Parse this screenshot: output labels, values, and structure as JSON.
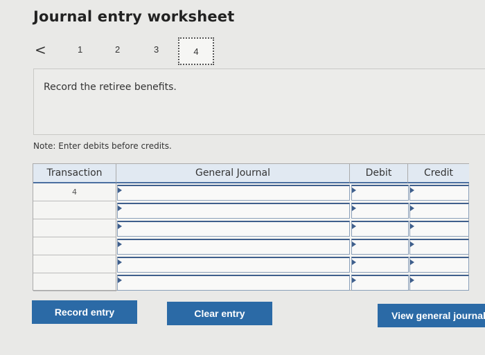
{
  "header": {
    "title": "Journal entry worksheet"
  },
  "pager": {
    "prev_icon": "chevron-left-icon",
    "prev_glyph": "<",
    "pages": [
      "1",
      "2",
      "3",
      "4"
    ],
    "current_page": "4"
  },
  "prompt": {
    "text": "Record the retiree benefits."
  },
  "note": "Note: Enter debits before credits.",
  "table": {
    "headers": {
      "transaction": "Transaction",
      "general_journal": "General Journal",
      "debit": "Debit",
      "credit": "Credit"
    },
    "rows": [
      {
        "transaction": "4",
        "account": "",
        "debit": "",
        "credit": ""
      },
      {
        "transaction": "",
        "account": "",
        "debit": "",
        "credit": ""
      },
      {
        "transaction": "",
        "account": "",
        "debit": "",
        "credit": ""
      },
      {
        "transaction": "",
        "account": "",
        "debit": "",
        "credit": ""
      },
      {
        "transaction": "",
        "account": "",
        "debit": "",
        "credit": ""
      },
      {
        "transaction": "",
        "account": "",
        "debit": "",
        "credit": ""
      }
    ]
  },
  "buttons": {
    "record_entry": "Record entry",
    "clear_entry": "Clear entry",
    "view_general_journal": "View general journal"
  },
  "colors": {
    "button_blue": "#2b6aa6",
    "header_bg": "#e1e9f2",
    "input_border": "#3f5f8c"
  }
}
